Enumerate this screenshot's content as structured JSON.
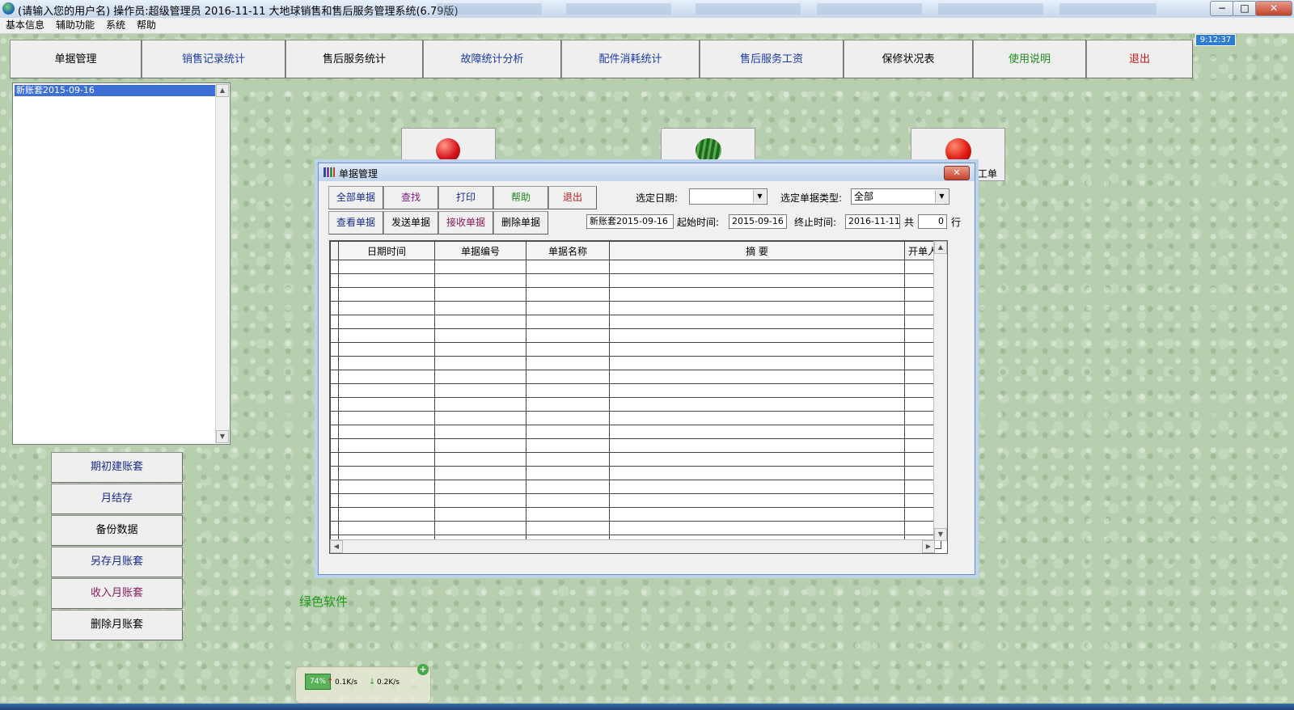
{
  "titlebar": {
    "title": "(请输入您的用户名) 操作员:超级管理员   2016-11-11  大地球销售和售后服务管理系统(6.79版)",
    "minimize": "−",
    "restore": "□",
    "close": "✕"
  },
  "menu": [
    "基本信息",
    "辅助功能",
    "系统",
    "帮助"
  ],
  "clock": "9:12:37",
  "nav": [
    {
      "label": "单据管理",
      "color": "#000000"
    },
    {
      "label": "销售记录统计",
      "color": "#1a3aa8"
    },
    {
      "label": "售后服务统计",
      "color": "#000000"
    },
    {
      "label": "故障统计分析",
      "color": "#1a3aa8"
    },
    {
      "label": "配件消耗统计",
      "color": "#1a3aa8"
    },
    {
      "label": "售后服务工资",
      "color": "#1a3aa8"
    },
    {
      "label": "保修状况表",
      "color": "#000000"
    },
    {
      "label": "使用说明",
      "color": "#1f8a1f"
    },
    {
      "label": "退出",
      "color": "#c01818"
    }
  ],
  "left_list": {
    "selected": "新账套2015-09-16"
  },
  "left_buttons": [
    {
      "label": "期初建账套",
      "color": "#1a2a8a"
    },
    {
      "label": "月结存",
      "color": "#1a2a8a"
    },
    {
      "label": "备份数据",
      "color": "#000000"
    },
    {
      "label": "另存月账套",
      "color": "#1a2a8a"
    },
    {
      "label": "收入月账套",
      "color": "#8a1a5a"
    },
    {
      "label": "删除月账套",
      "color": "#000000"
    }
  ],
  "tiles": {
    "third_partial_label": "工单"
  },
  "dialog": {
    "title": "单据管理",
    "close": "✕",
    "row1_buttons": [
      {
        "label": "全部单据",
        "color": "#1a2a8a"
      },
      {
        "label": "查找",
        "color": "#7a1a7a"
      },
      {
        "label": "打印",
        "color": "#1a2a8a"
      },
      {
        "label": "帮助",
        "color": "#1f8a1f"
      },
      {
        "label": "退出",
        "color": "#c01818"
      }
    ],
    "row2_buttons": [
      {
        "label": "查看单据",
        "color": "#1a2a8a"
      },
      {
        "label": "发送单据",
        "color": "#000000"
      },
      {
        "label": "接收单据",
        "color": "#8a1a5a"
      },
      {
        "label": "删除单据",
        "color": "#000000"
      }
    ],
    "date_label": "选定日期:",
    "date_value": "",
    "type_label": "选定单据类型:",
    "type_value": "全部",
    "account_value": "新账套2015-09-16",
    "start_label": "起始时间:",
    "start_value": "2015-09-16",
    "end_label": "终止时间:",
    "end_value": "2016-11-11",
    "total_label": "共",
    "total_value": "0",
    "rows_label": "行",
    "columns": [
      "日期时间",
      "单据编号",
      "单据名称",
      "摘  要",
      "开单人"
    ]
  },
  "brand": "绿色软件",
  "netwidget": {
    "percent": "74%",
    "up": "0.1K/s",
    "down": "0.2K/s",
    "plus": "+"
  }
}
